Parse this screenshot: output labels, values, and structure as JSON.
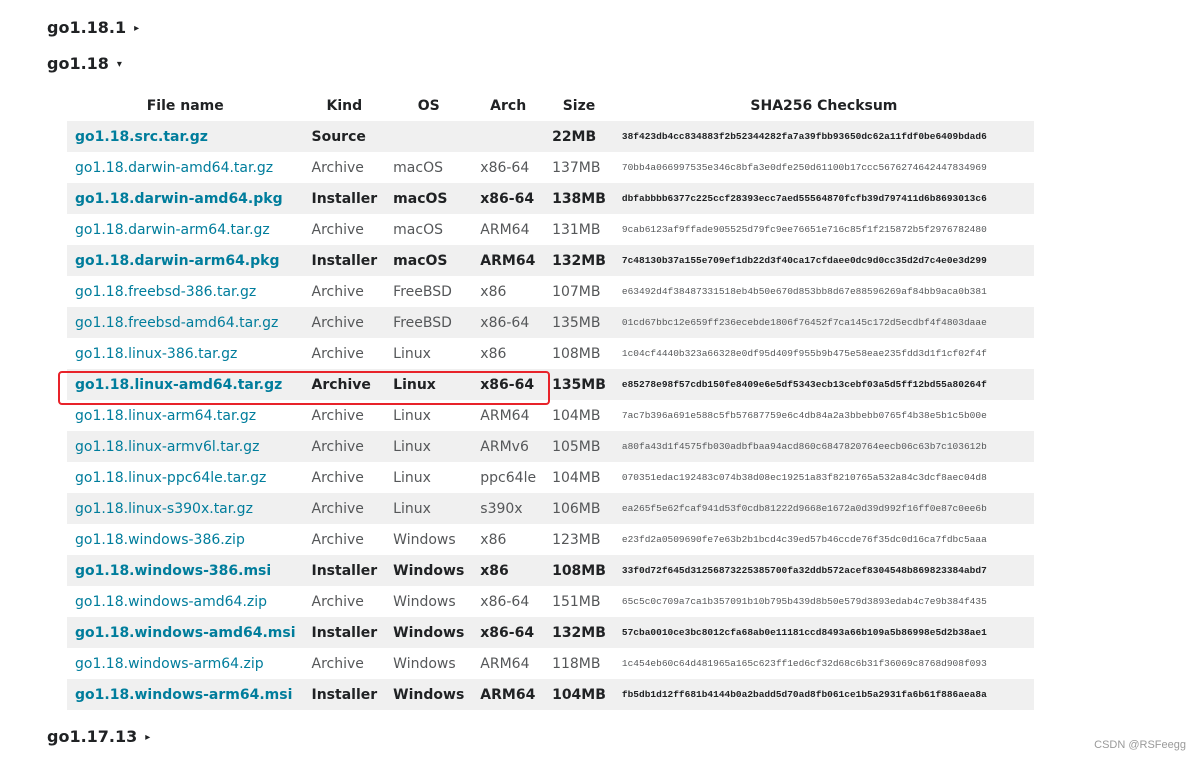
{
  "releases": {
    "prev": {
      "label": "go1.18.1",
      "arrow": "▸"
    },
    "current": {
      "label": "go1.18",
      "arrow": "▾"
    },
    "next": {
      "label": "go1.17.13",
      "arrow": "▸"
    }
  },
  "table": {
    "headers": {
      "file": "File name",
      "kind": "Kind",
      "os": "OS",
      "arch": "Arch",
      "size": "Size",
      "checksum": "SHA256 Checksum"
    },
    "rows": [
      {
        "file": "go1.18.src.tar.gz",
        "kind": "Source",
        "os": "",
        "arch": "",
        "size": "22MB",
        "checksum": "38f423db4cc834883f2b52344282fa7a39fbb93650dc62a11fdf0be6409bdad6"
      },
      {
        "file": "go1.18.darwin-amd64.tar.gz",
        "kind": "Archive",
        "os": "macOS",
        "arch": "x86-64",
        "size": "137MB",
        "checksum": "70bb4a066997535e346c8bfa3e0dfe250d61100b17ccc5676274642447834969"
      },
      {
        "file": "go1.18.darwin-amd64.pkg",
        "kind": "Installer",
        "os": "macOS",
        "arch": "x86-64",
        "size": "138MB",
        "checksum": "dbfabbbb6377c225ccf28393ecc7aed55564870fcfb39d797411d6b8693013c6"
      },
      {
        "file": "go1.18.darwin-arm64.tar.gz",
        "kind": "Archive",
        "os": "macOS",
        "arch": "ARM64",
        "size": "131MB",
        "checksum": "9cab6123af9ffade905525d79fc9ee76651e716c85f1f215872b5f2976782480"
      },
      {
        "file": "go1.18.darwin-arm64.pkg",
        "kind": "Installer",
        "os": "macOS",
        "arch": "ARM64",
        "size": "132MB",
        "checksum": "7c48130b37a155e709ef1db22d3f40ca17cfdaee0dc9d0cc35d2d7c4e0e3d299"
      },
      {
        "file": "go1.18.freebsd-386.tar.gz",
        "kind": "Archive",
        "os": "FreeBSD",
        "arch": "x86",
        "size": "107MB",
        "checksum": "e63492d4f38487331518eb4b50e670d853bb8d67e88596269af84bb9aca0b381"
      },
      {
        "file": "go1.18.freebsd-amd64.tar.gz",
        "kind": "Archive",
        "os": "FreeBSD",
        "arch": "x86-64",
        "size": "135MB",
        "checksum": "01cd67bbc12e659ff236ecebde1806f76452f7ca145c172d5ecdbf4f4803daae"
      },
      {
        "file": "go1.18.linux-386.tar.gz",
        "kind": "Archive",
        "os": "Linux",
        "arch": "x86",
        "size": "108MB",
        "checksum": "1c04cf4440b323a66328e0df95d409f955b9b475e58eae235fdd3d1f1cf02f4f"
      },
      {
        "file": "go1.18.linux-amd64.tar.gz",
        "kind": "Archive",
        "os": "Linux",
        "arch": "x86-64",
        "size": "135MB",
        "checksum": "e85278e98f57cdb150fe8409e6e5df5343ecb13cebf03a5d5ff12bd55a80264f"
      },
      {
        "file": "go1.18.linux-arm64.tar.gz",
        "kind": "Archive",
        "os": "Linux",
        "arch": "ARM64",
        "size": "104MB",
        "checksum": "7ac7b396a691e588c5fb57687759e6c4db84a2a3bbebb0765f4b38e5b1c5b00e"
      },
      {
        "file": "go1.18.linux-armv6l.tar.gz",
        "kind": "Archive",
        "os": "Linux",
        "arch": "ARMv6",
        "size": "105MB",
        "checksum": "a80fa43d1f4575fb030adbfbaa94acd860c6847820764eecb06c63b7c103612b"
      },
      {
        "file": "go1.18.linux-ppc64le.tar.gz",
        "kind": "Archive",
        "os": "Linux",
        "arch": "ppc64le",
        "size": "104MB",
        "checksum": "070351edac192483c074b38d08ec19251a83f8210765a532a84c3dcf8aec04d8"
      },
      {
        "file": "go1.18.linux-s390x.tar.gz",
        "kind": "Archive",
        "os": "Linux",
        "arch": "s390x",
        "size": "106MB",
        "checksum": "ea265f5e62fcaf941d53f0cdb81222d9668e1672a0d39d992f16ff0e87c0ee6b"
      },
      {
        "file": "go1.18.windows-386.zip",
        "kind": "Archive",
        "os": "Windows",
        "arch": "x86",
        "size": "123MB",
        "checksum": "e23fd2a0509690fe7e63b2b1bcd4c39ed57b46ccde76f35dc0d16ca7fdbc5aaa"
      },
      {
        "file": "go1.18.windows-386.msi",
        "kind": "Installer",
        "os": "Windows",
        "arch": "x86",
        "size": "108MB",
        "checksum": "33f0d72f645d31256873225385700fa32ddb572acef8304548b869823384abd7"
      },
      {
        "file": "go1.18.windows-amd64.zip",
        "kind": "Archive",
        "os": "Windows",
        "arch": "x86-64",
        "size": "151MB",
        "checksum": "65c5c0c709a7ca1b357091b10b795b439d8b50e579d3893edab4c7e9b384f435"
      },
      {
        "file": "go1.18.windows-amd64.msi",
        "kind": "Installer",
        "os": "Windows",
        "arch": "x86-64",
        "size": "132MB",
        "checksum": "57cba0010ce3bc8012cfa68ab0e11181ccd8493a66b109a5b86998e5d2b38ae1"
      },
      {
        "file": "go1.18.windows-arm64.zip",
        "kind": "Archive",
        "os": "Windows",
        "arch": "ARM64",
        "size": "118MB",
        "checksum": "1c454eb60c64d481965a165c623ff1ed6cf32d68c6b31f36069c8768d908f093"
      },
      {
        "file": "go1.18.windows-arm64.msi",
        "kind": "Installer",
        "os": "Windows",
        "arch": "ARM64",
        "size": "104MB",
        "checksum": "fb5db1d12ff681b4144b0a2badd5d70ad8fb061ce1b5a2931fa6b61f886aea8a"
      }
    ]
  },
  "watermark": "CSDN @RSFeegg",
  "colors": {
    "link": "#007d9c",
    "highlight": "#e8232a"
  }
}
